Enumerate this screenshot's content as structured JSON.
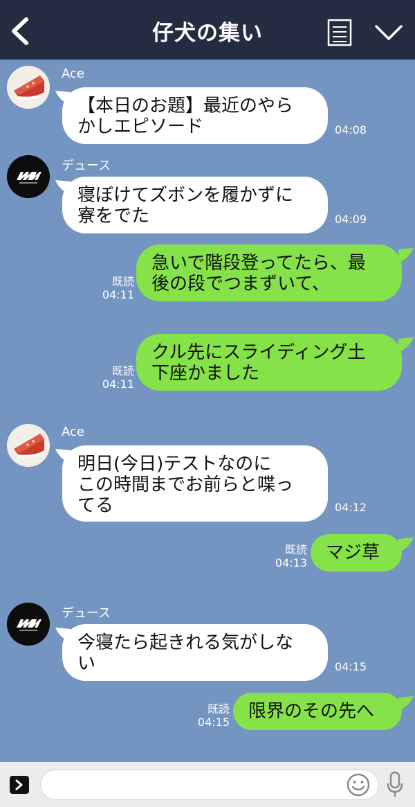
{
  "header": {
    "title": "仔犬の集い",
    "back_icon": "chevron-left-icon",
    "menu_icon": "memo-icon",
    "dropdown_icon": "chevron-down-icon",
    "bg_color": "#232c40"
  },
  "chat": {
    "bg_color": "#7494c1",
    "outgoing_color": "#85e249",
    "incoming_color": "#ffffff",
    "messages": [
      {
        "sender": "Ace",
        "lines": [
          "【本日のお題】最近のやら",
          "かしエピソード"
        ],
        "time": "04:08"
      },
      {
        "sender": "デュース",
        "lines": [
          "寝ぼけてズボンを履かずに",
          "寮をでた"
        ],
        "time": "04:09"
      },
      {
        "read": "既読",
        "lines": [
          "急いで階段登ってたら、最",
          "後の段でつまずいて、"
        ],
        "time": "04:11"
      },
      {
        "read": "既読",
        "lines": [
          "クル先にスライディング土",
          "下座かました"
        ],
        "time": "04:11"
      },
      {
        "sender": "Ace",
        "lines": [
          "明日(今日)テストなのに",
          "この時間までお前らと喋っ",
          "てる"
        ],
        "time": "04:12"
      },
      {
        "read": "既読",
        "lines": [
          "マジ草"
        ],
        "time": "04:13"
      },
      {
        "sender": "デュース",
        "lines": [
          "今寝たら起きれる気がしな",
          "い"
        ],
        "time": "04:15"
      },
      {
        "read": "既読",
        "lines": [
          "限界のその先へ"
        ],
        "time": "04:15"
      }
    ]
  },
  "footer": {
    "input_placeholder": "",
    "expand_icon": "chevron-right-icon",
    "emoji_icon": "smiley-icon",
    "mic_icon": "microphone-icon"
  }
}
